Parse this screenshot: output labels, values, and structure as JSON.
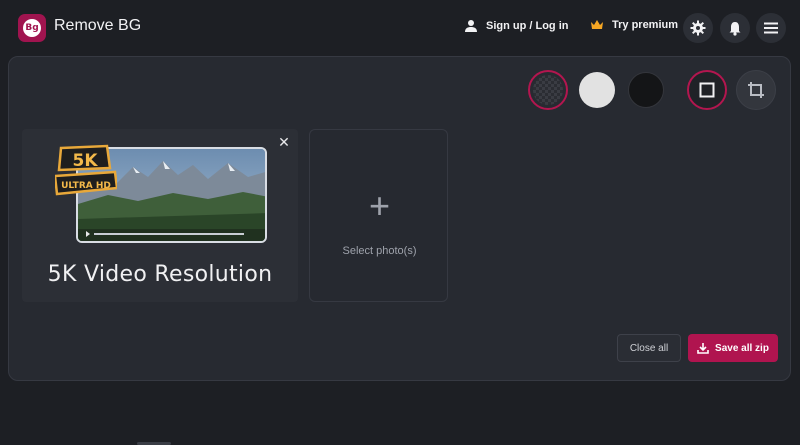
{
  "app": {
    "title": "Remove BG",
    "logo_text": "Bg",
    "accent": "#b0144f"
  },
  "header": {
    "signup_label": "Sign up / Log in",
    "premium_label": "Try premium",
    "icons": [
      "user-icon",
      "crown-icon",
      "gear-icon",
      "bell-icon",
      "menu-icon"
    ]
  },
  "background_options": [
    "transparent",
    "white",
    "black"
  ],
  "selected_background": "transparent",
  "tools": [
    "resize-icon",
    "crop-icon"
  ],
  "uploaded": {
    "badge_top": "5K",
    "badge_bottom": "ULTRA HD",
    "caption": "5K Video Resolution"
  },
  "add_card": {
    "label": "Select photo(s)"
  },
  "actions": {
    "close_all": "Close all",
    "save_all": "Save all zip"
  }
}
